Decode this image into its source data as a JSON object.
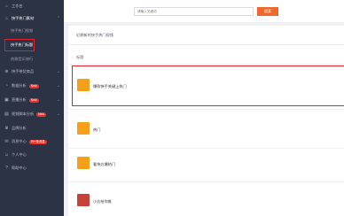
{
  "sidebar": {
    "items": [
      {
        "label": "工作台",
        "icon": "home-icon"
      },
      {
        "label": "快手热门素材",
        "icon": "flame-icon",
        "expanded": true
      },
      {
        "label": "快手带货商品",
        "icon": "cart-icon"
      },
      {
        "label": "数据分析",
        "icon": "chart-icon",
        "badge": "New"
      },
      {
        "label": "直播分析",
        "icon": "live-icon",
        "badge": "New"
      },
      {
        "label": "视频脚本分析",
        "icon": "video-icon",
        "badge": "New"
      },
      {
        "label": "品牌分析",
        "icon": "brand-icon"
      },
      {
        "label": "消息中心",
        "icon": "bell-icon",
        "badge": "99+条消息"
      },
      {
        "label": "个人中心",
        "icon": "user-icon"
      },
      {
        "label": "帮助中心",
        "icon": "help-icon"
      }
    ],
    "sub_items": [
      {
        "label": "快手热门视频"
      },
      {
        "label": "快手热门标题"
      },
      {
        "label": "热歌音乐排行"
      }
    ]
  },
  "search": {
    "placeholder": "请输入关键词",
    "button_label": "搜索"
  },
  "main": {
    "note": "近期新的快手热门视频",
    "column_header": "标题",
    "rows": [
      {
        "title": "爆款快手关键上热门",
        "thumb_color": "#f5a018"
      },
      {
        "title": "热门",
        "thumb_color": "#f5a018"
      },
      {
        "title": "看快方爆热门",
        "thumb_color": "#f5a018"
      },
      {
        "title": "小方给你推",
        "thumb_color": "#c8403a"
      }
    ]
  },
  "colors": {
    "accent": "#f0682c",
    "highlight": "#e0202a",
    "sidebar_bg": "#2c3344"
  }
}
